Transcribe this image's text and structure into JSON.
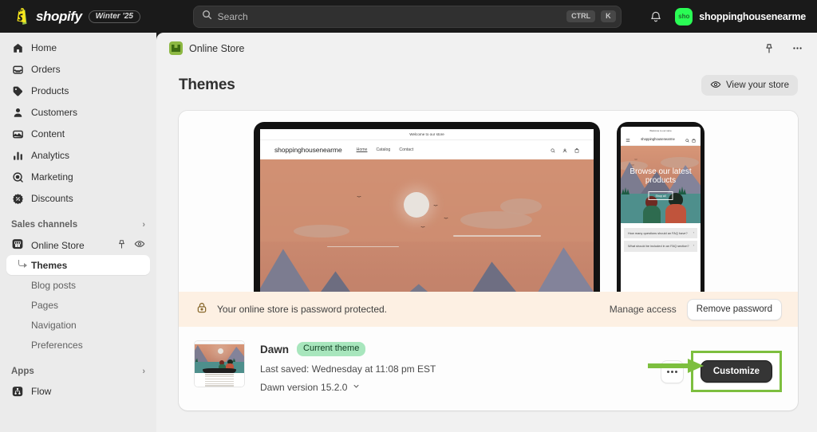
{
  "topbar": {
    "brand_name": "shopify",
    "season_badge": "Winter '25",
    "search_placeholder": "Search",
    "shortcut_ctrl": "CTRL",
    "shortcut_key": "K",
    "notifications_icon": "bell-icon",
    "avatar_initials": "sho",
    "account_name": "shoppinghousenearme",
    "avatar_color": "#2afc55"
  },
  "sidebar": {
    "items": [
      {
        "label": "Home",
        "icon": "home-icon"
      },
      {
        "label": "Orders",
        "icon": "orders-inbox-icon"
      },
      {
        "label": "Products",
        "icon": "product-tag-icon"
      },
      {
        "label": "Customers",
        "icon": "person-icon"
      },
      {
        "label": "Content",
        "icon": "content-media-icon"
      },
      {
        "label": "Analytics",
        "icon": "bar-chart-icon"
      },
      {
        "label": "Marketing",
        "icon": "megaphone-target-icon"
      },
      {
        "label": "Discounts",
        "icon": "discount-tag-icon"
      }
    ],
    "sales_channels": {
      "label": "Sales channels",
      "chevron_icon": "chevron-right-icon",
      "channel": {
        "label": "Online Store",
        "icon": "storefront-icon",
        "pin_icon": "pin-icon",
        "view_icon": "eye-icon"
      },
      "sub_items": [
        {
          "label": "Themes",
          "active": true
        },
        {
          "label": "Blog posts",
          "active": false
        },
        {
          "label": "Pages",
          "active": false
        },
        {
          "label": "Navigation",
          "active": false
        },
        {
          "label": "Preferences",
          "active": false
        }
      ]
    },
    "apps": {
      "label": "Apps",
      "chevron_icon": "chevron-right-icon",
      "items": [
        {
          "label": "Flow",
          "icon": "flow-icon"
        }
      ]
    }
  },
  "main": {
    "breadcrumb": {
      "label": "Online Store",
      "icon": "online-store-icon"
    },
    "header_actions": {
      "pin_icon": "pin-icon",
      "more_icon": "more-horizontal-icon"
    },
    "page_title": "Themes",
    "view_store_button": {
      "label": "View your store",
      "icon": "eye-icon"
    },
    "password_banner": {
      "icon": "lock-icon",
      "message": "Your online store is password protected.",
      "manage_access_label": "Manage access",
      "remove_password_label": "Remove password",
      "background_color": "#fdf0e3"
    },
    "theme": {
      "name": "Dawn",
      "badge": "Current theme",
      "badge_color": "#a8e6bd",
      "last_saved": "Last saved: Wednesday at 11:08 pm EST",
      "version": "Dawn version 15.2.0",
      "version_chevron_icon": "chevron-down-icon",
      "more_actions_icon": "more-horizontal-icon",
      "customize_button": "Customize",
      "highlight_color": "#7dbf3f",
      "annotation_arrow_icon": "green-arrow-icon"
    },
    "storefront_preview": {
      "desktop": {
        "announcement": "Welcome to our store",
        "logo": "shoppinghousenearme",
        "nav_links": [
          "Home",
          "Catalog",
          "Contact"
        ],
        "icons": [
          "search-icon",
          "account-icon",
          "cart-icon"
        ]
      },
      "mobile": {
        "announcement": "Welcome to our store",
        "logo": "shoppinghousenearme",
        "menu_icon": "hamburger-icon",
        "icons": [
          "search-icon",
          "cart-icon"
        ],
        "hero_heading": "Browse our latest products",
        "hero_button": "Shop all",
        "faq_items": [
          "How many questions should an FAQ have?",
          "What should be included in an FAQ section?"
        ]
      }
    }
  }
}
